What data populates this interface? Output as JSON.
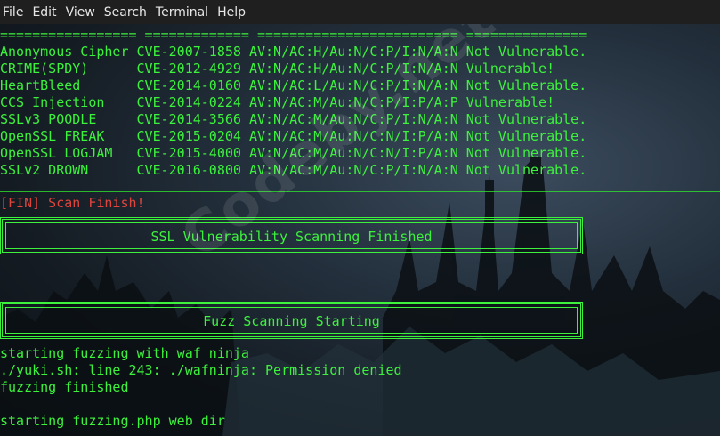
{
  "menu": [
    "File",
    "Edit",
    "View",
    "Search",
    "Terminal",
    "Help"
  ],
  "separator": "================= ============= ========================= ===============",
  "rows": [
    {
      "text": "Anonymous Cipher CVE-2007-1858 AV:N/AC:H/Au:N/C:P/I:N/A:N Not Vulnerable."
    },
    {
      "text": "CRIME(SPDY)      CVE-2012-4929 AV:N/AC:H/Au:N/C:P/I:N/A:N Vulnerable!"
    },
    {
      "text": "HeartBleed       CVE-2014-0160 AV:N/AC:L/Au:N/C:P/I:N/A:N Not Vulnerable."
    },
    {
      "text": "CCS Injection    CVE-2014-0224 AV:N/AC:M/Au:N/C:P/I:P/A:P Vulnerable!"
    },
    {
      "text": "SSLv3 POODLE     CVE-2014-3566 AV:N/AC:M/Au:N/C:P/I:N/A:N Not Vulnerable."
    },
    {
      "text": "OpenSSL FREAK    CVE-2015-0204 AV:N/AC:M/Au:N/C:N/I:P/A:N Not Vulnerable."
    },
    {
      "text": "OpenSSL LOGJAM   CVE-2015-4000 AV:N/AC:M/Au:N/C:N/I:P/A:N Not Vulnerable."
    },
    {
      "text": "SSLv2 DROWN      CVE-2016-0800 AV:N/AC:M/Au:N/C:P/I:N/A:N Not Vulnerable."
    }
  ],
  "fin_line": "[FIN] Scan Finish!",
  "banner1": "SSL Vulnerability Scanning Finished",
  "banner2": "Fuzz Scanning Starting",
  "out1": "starting fuzzing with waf ninja",
  "out2": "./yuki.sh: line 243: ./wafninja: Permission denied",
  "out3": "fuzzing finished",
  "out4": "starting fuzzing.php web dir",
  "watermark": "Codeby.net",
  "colors": {
    "green": "#3cf23c",
    "red": "#e0453d",
    "menubar": "#1f1f1f"
  }
}
